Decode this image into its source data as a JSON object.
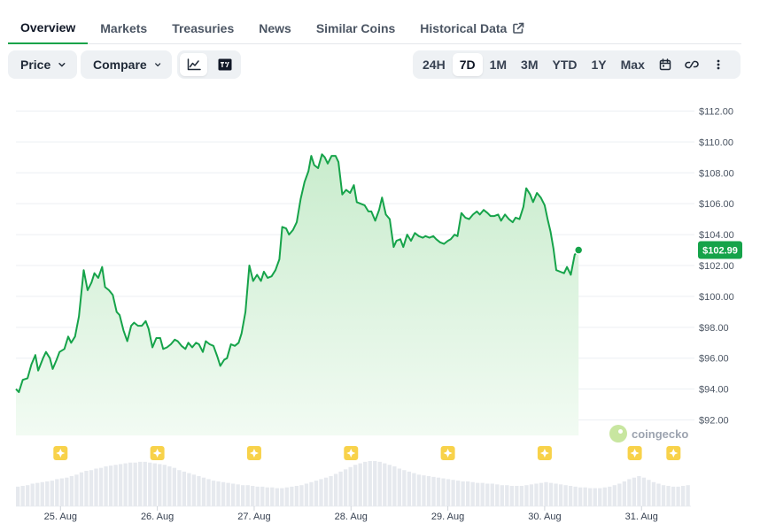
{
  "tabs": [
    {
      "label": "Overview",
      "active": true
    },
    {
      "label": "Markets",
      "active": false
    },
    {
      "label": "Treasuries",
      "active": false
    },
    {
      "label": "News",
      "active": false
    },
    {
      "label": "Similar Coins",
      "active": false
    },
    {
      "label": "Historical Data",
      "active": false
    }
  ],
  "toolbar": {
    "price_label": "Price",
    "compare_label": "Compare",
    "chart_types": [
      {
        "icon": "line-chart-icon",
        "active": true
      },
      {
        "icon": "tradingview-icon",
        "active": false
      }
    ],
    "ranges": [
      {
        "label": "24H",
        "active": false
      },
      {
        "label": "7D",
        "active": true
      },
      {
        "label": "1M",
        "active": false
      },
      {
        "label": "3M",
        "active": false
      },
      {
        "label": "YTD",
        "active": false
      },
      {
        "label": "1Y",
        "active": false
      },
      {
        "label": "Max",
        "active": false
      }
    ],
    "icons": [
      "calendar-icon",
      "link-icon",
      "more-vertical-icon"
    ]
  },
  "colors": {
    "line": "#16a34a",
    "fill_top": "#c9eccd",
    "fill_bottom": "#f2fbf3",
    "grid": "#eceff3",
    "volume": "#e6e9ee",
    "event": "#f8d24a",
    "active_tab": "#16a34a"
  },
  "watermark": "coingecko",
  "chart_data": {
    "type": "area",
    "x_unit": "days since 25 Aug 00:00",
    "ylim": [
      91,
      113
    ],
    "yticks": [
      92,
      94,
      96,
      98,
      100,
      102,
      104,
      106,
      108,
      110,
      112
    ],
    "ytick_labels": [
      "$92.00",
      "$94.00",
      "$96.00",
      "$98.00",
      "$100.00",
      "$102.00",
      "$104.00",
      "$106.00",
      "$108.00",
      "$110.00",
      "$112.00"
    ],
    "xlim": [
      -0.46,
      6.51
    ],
    "xticks": [
      0,
      1,
      2,
      3,
      4,
      5,
      6
    ],
    "xtick_labels": [
      "25. Aug",
      "26. Aug",
      "27. Aug",
      "28. Aug",
      "29. Aug",
      "30. Aug",
      "31. Aug"
    ],
    "last_value_label": "$102.99",
    "series": [
      {
        "points": [
          [
            -0.46,
            94.0
          ],
          [
            -0.43,
            93.8
          ],
          [
            -0.39,
            94.6
          ],
          [
            -0.34,
            94.7
          ],
          [
            -0.3,
            95.6
          ],
          [
            -0.26,
            96.2
          ],
          [
            -0.23,
            95.2
          ],
          [
            -0.18,
            96.0
          ],
          [
            -0.15,
            96.4
          ],
          [
            -0.11,
            96.0
          ],
          [
            -0.08,
            95.3
          ],
          [
            -0.04,
            95.9
          ],
          [
            -0.01,
            96.4
          ],
          [
            0.04,
            96.6
          ],
          [
            0.08,
            97.4
          ],
          [
            0.11,
            97.0
          ],
          [
            0.15,
            97.4
          ],
          [
            0.19,
            98.7
          ],
          [
            0.24,
            101.7
          ],
          [
            0.28,
            100.4
          ],
          [
            0.32,
            100.9
          ],
          [
            0.35,
            101.5
          ],
          [
            0.39,
            101.2
          ],
          [
            0.43,
            101.9
          ],
          [
            0.46,
            100.6
          ],
          [
            0.5,
            100.4
          ],
          [
            0.54,
            100.1
          ],
          [
            0.58,
            99.0
          ],
          [
            0.61,
            98.8
          ],
          [
            0.65,
            97.8
          ],
          [
            0.69,
            97.1
          ],
          [
            0.73,
            98.1
          ],
          [
            0.76,
            98.3
          ],
          [
            0.8,
            98.1
          ],
          [
            0.84,
            98.1
          ],
          [
            0.88,
            98.4
          ],
          [
            0.91,
            97.9
          ],
          [
            0.95,
            96.7
          ],
          [
            0.99,
            97.3
          ],
          [
            1.03,
            97.3
          ],
          [
            1.06,
            96.6
          ],
          [
            1.1,
            96.7
          ],
          [
            1.14,
            96.9
          ],
          [
            1.18,
            97.2
          ],
          [
            1.21,
            97.1
          ],
          [
            1.25,
            96.8
          ],
          [
            1.29,
            96.6
          ],
          [
            1.32,
            97.0
          ],
          [
            1.36,
            96.7
          ],
          [
            1.4,
            97.0
          ],
          [
            1.43,
            96.9
          ],
          [
            1.47,
            96.4
          ],
          [
            1.5,
            97.1
          ],
          [
            1.54,
            96.9
          ],
          [
            1.58,
            96.8
          ],
          [
            1.62,
            96.1
          ],
          [
            1.65,
            95.5
          ],
          [
            1.69,
            95.9
          ],
          [
            1.72,
            96.0
          ],
          [
            1.76,
            96.9
          ],
          [
            1.8,
            96.8
          ],
          [
            1.84,
            97.0
          ],
          [
            1.87,
            97.6
          ],
          [
            1.91,
            99.0
          ],
          [
            1.95,
            102.0
          ],
          [
            1.99,
            101.0
          ],
          [
            2.03,
            101.4
          ],
          [
            2.07,
            101.0
          ],
          [
            2.1,
            101.6
          ],
          [
            2.14,
            101.2
          ],
          [
            2.18,
            101.3
          ],
          [
            2.22,
            101.7
          ],
          [
            2.26,
            102.4
          ],
          [
            2.29,
            104.5
          ],
          [
            2.33,
            104.4
          ],
          [
            2.36,
            104.0
          ],
          [
            2.4,
            104.3
          ],
          [
            2.44,
            104.8
          ],
          [
            2.48,
            106.3
          ],
          [
            2.52,
            107.4
          ],
          [
            2.56,
            108.1
          ],
          [
            2.59,
            109.1
          ],
          [
            2.62,
            108.5
          ],
          [
            2.66,
            108.3
          ],
          [
            2.7,
            109.2
          ],
          [
            2.73,
            109.0
          ],
          [
            2.76,
            108.6
          ],
          [
            2.8,
            109.1
          ],
          [
            2.84,
            109.1
          ],
          [
            2.87,
            108.7
          ],
          [
            2.91,
            106.6
          ],
          [
            2.95,
            106.9
          ],
          [
            2.99,
            106.7
          ],
          [
            3.03,
            107.2
          ],
          [
            3.06,
            106.1
          ],
          [
            3.1,
            106.0
          ],
          [
            3.14,
            105.9
          ],
          [
            3.18,
            105.5
          ],
          [
            3.21,
            105.5
          ],
          [
            3.25,
            104.9
          ],
          [
            3.29,
            105.6
          ],
          [
            3.32,
            106.4
          ],
          [
            3.36,
            105.3
          ],
          [
            3.4,
            105.0
          ],
          [
            3.44,
            103.2
          ],
          [
            3.47,
            103.6
          ],
          [
            3.51,
            103.7
          ],
          [
            3.54,
            103.2
          ],
          [
            3.58,
            104.0
          ],
          [
            3.62,
            103.6
          ],
          [
            3.66,
            104.1
          ],
          [
            3.7,
            103.9
          ],
          [
            3.74,
            103.8
          ],
          [
            3.77,
            103.9
          ],
          [
            3.81,
            103.8
          ],
          [
            3.85,
            103.9
          ],
          [
            3.88,
            103.7
          ],
          [
            3.92,
            103.5
          ],
          [
            3.96,
            103.4
          ],
          [
            4.0,
            103.6
          ],
          [
            4.03,
            103.7
          ],
          [
            4.07,
            104.0
          ],
          [
            4.1,
            103.9
          ],
          [
            4.14,
            105.4
          ],
          [
            4.18,
            105.1
          ],
          [
            4.22,
            105.0
          ],
          [
            4.26,
            105.3
          ],
          [
            4.3,
            105.5
          ],
          [
            4.33,
            105.3
          ],
          [
            4.37,
            105.6
          ],
          [
            4.41,
            105.4
          ],
          [
            4.44,
            105.2
          ],
          [
            4.48,
            105.2
          ],
          [
            4.52,
            105.3
          ],
          [
            4.55,
            104.9
          ],
          [
            4.59,
            105.3
          ],
          [
            4.63,
            105.0
          ],
          [
            4.67,
            104.8
          ],
          [
            4.7,
            105.1
          ],
          [
            4.74,
            105.0
          ],
          [
            4.78,
            105.8
          ],
          [
            4.81,
            107.0
          ],
          [
            4.85,
            106.6
          ],
          [
            4.88,
            106.1
          ],
          [
            4.92,
            106.7
          ],
          [
            4.96,
            106.4
          ],
          [
            5.0,
            105.9
          ],
          [
            5.03,
            105.0
          ],
          [
            5.06,
            104.2
          ],
          [
            5.09,
            103.1
          ],
          [
            5.12,
            101.7
          ],
          [
            5.16,
            101.6
          ],
          [
            5.2,
            101.5
          ],
          [
            5.23,
            101.9
          ],
          [
            5.27,
            101.4
          ],
          [
            5.31,
            102.7
          ],
          [
            5.35,
            103.0
          ]
        ]
      }
    ],
    "volume": [
      26,
      27,
      28,
      30,
      31,
      32,
      33,
      34,
      36,
      37,
      38,
      40,
      42,
      45,
      47,
      48,
      50,
      51,
      53,
      54,
      55,
      56,
      57,
      58,
      58,
      59,
      59,
      58,
      57,
      56,
      55,
      53,
      51,
      48,
      46,
      44,
      42,
      40,
      38,
      36,
      34,
      33,
      32,
      31,
      30,
      29,
      28,
      28,
      27,
      26,
      26,
      25,
      25,
      24,
      24,
      25,
      26,
      27,
      28,
      30,
      32,
      34,
      36,
      38,
      40,
      43,
      46,
      49,
      52,
      55,
      57,
      59,
      60,
      60,
      59,
      57,
      55,
      53,
      50,
      48,
      46,
      44,
      42,
      41,
      40,
      39,
      38,
      37,
      36,
      35,
      34,
      33,
      33,
      32,
      31,
      31,
      30,
      30,
      29,
      28,
      28,
      27,
      27,
      27,
      28,
      29,
      30,
      31,
      32,
      31,
      30,
      29,
      28,
      27,
      26,
      25,
      25,
      24,
      24,
      24,
      25,
      26,
      28,
      30,
      33,
      36,
      38,
      40,
      38,
      35,
      32,
      30,
      28,
      27,
      26,
      26,
      27,
      28
    ],
    "events": [
      0.0,
      1.0,
      2.0,
      3.0,
      4.0,
      5.0,
      5.93,
      6.33
    ]
  }
}
